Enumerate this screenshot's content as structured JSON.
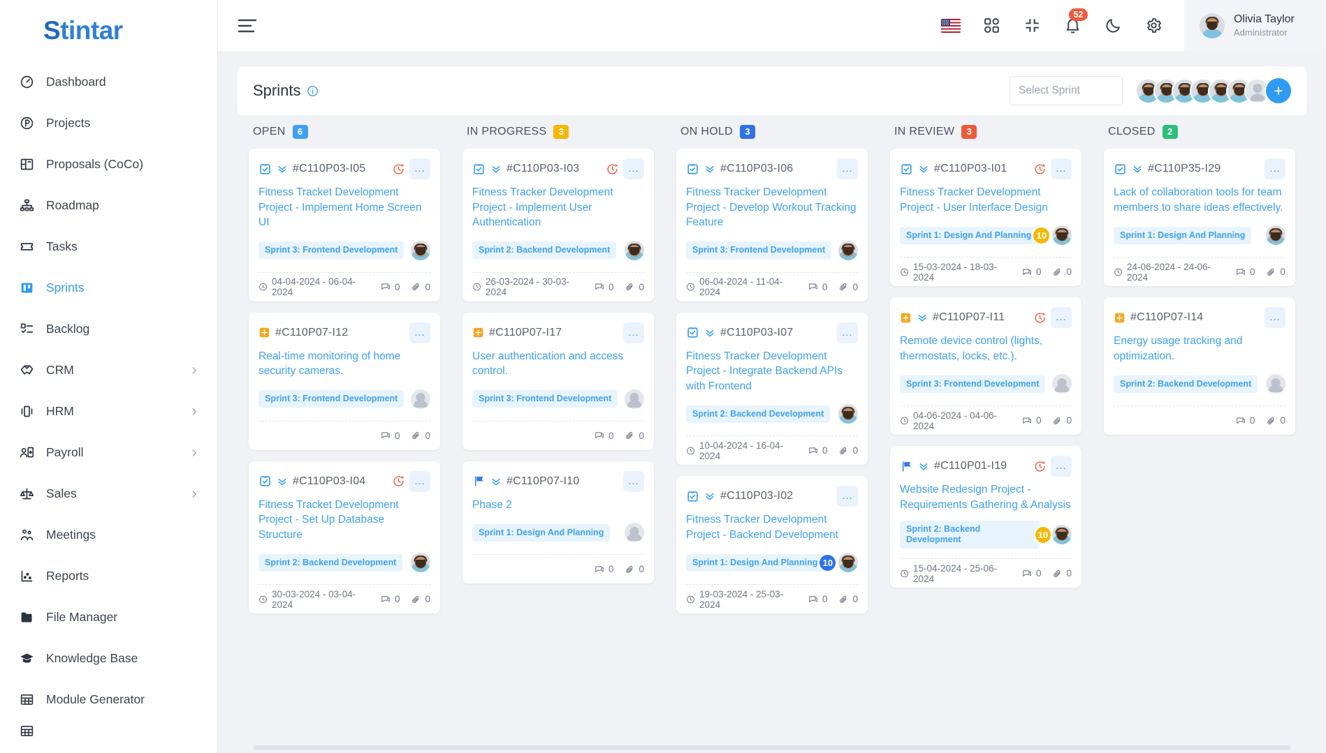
{
  "sidebar": {
    "logo": "Stintar",
    "logo_mark": "S",
    "items": [
      {
        "label": "Dashboard",
        "icon": "speedometer-icon",
        "expandable": false,
        "active": false
      },
      {
        "label": "Projects",
        "icon": "projects-circle-p-icon",
        "expandable": false,
        "active": false
      },
      {
        "label": "Proposals (CoCo)",
        "icon": "proposals-icon",
        "expandable": false,
        "active": false
      },
      {
        "label": "Roadmap",
        "icon": "roadmap-hierarchy-icon",
        "expandable": false,
        "active": false
      },
      {
        "label": "Tasks",
        "icon": "tasks-ticket-icon",
        "expandable": false,
        "active": false
      },
      {
        "label": "Sprints",
        "icon": "sprints-board-icon",
        "expandable": false,
        "active": true
      },
      {
        "label": "Backlog",
        "icon": "backlog-checklist-icon",
        "expandable": false,
        "active": false
      },
      {
        "label": "CRM",
        "icon": "crm-handshake-icon",
        "expandable": true,
        "active": false
      },
      {
        "label": "HRM",
        "icon": "hrm-idcard-icon",
        "expandable": true,
        "active": false
      },
      {
        "label": "Payroll",
        "icon": "payroll-person-icon",
        "expandable": true,
        "active": false
      },
      {
        "label": "Sales",
        "icon": "sales-scale-icon",
        "expandable": true,
        "active": false
      },
      {
        "label": "Meetings",
        "icon": "meetings-people-icon",
        "expandable": false,
        "active": false
      },
      {
        "label": "Reports",
        "icon": "reports-scatter-icon",
        "expandable": false,
        "active": false
      },
      {
        "label": "File Manager",
        "icon": "folder-icon",
        "expandable": false,
        "active": false
      },
      {
        "label": "Knowledge Base",
        "icon": "graduation-cap-icon",
        "expandable": false,
        "active": false
      },
      {
        "label": "Module Generator",
        "icon": "grid-table-icon",
        "expandable": false,
        "active": false
      }
    ]
  },
  "topbar": {
    "menu_icon": "hamburger-menu-icon",
    "language_flag": "us-flag-icon",
    "apps_icon": "apps-grid-icon",
    "fullscreen_icon": "exit-fullscreen-icon",
    "notifications_icon": "bell-icon",
    "notifications_count": "52",
    "theme_icon": "moon-icon",
    "settings_icon": "gear-icon",
    "user_name": "Olivia Taylor",
    "user_role": "Administrator"
  },
  "sprint_header": {
    "title": "Sprints",
    "info_icon": "info-circle-icon",
    "select_placeholder": "Select Sprint",
    "member_avatars": 6,
    "has_placeholder_avatar": true,
    "add_label": "+"
  },
  "colors": {
    "open": "#3fa1ef",
    "in_progress": "#f5b800",
    "on_hold": "#2f72e8",
    "in_review": "#f05a3c",
    "closed": "#2bbf7a",
    "accent": "#2f9bf2",
    "overdue": "#f05a3c"
  },
  "board": {
    "columns": [
      {
        "name": "OPEN",
        "count": "6",
        "color_key": "open",
        "cards": [
          {
            "type_icon": "task-checkbox-icon",
            "priority_icon": "double-chevron-down-icon",
            "id": "#C110P03-I05",
            "overdue": true,
            "menu": "…",
            "title": "Fitness Tracket Development Project - Implement Home Screen UI",
            "sprint": "Sprint 3: Frontend Development",
            "points": null,
            "points_color": null,
            "assignee": "photo",
            "dates": "04-04-2024 - 06-04-2024",
            "comments": "0",
            "attachments": "0",
            "show_dates": true
          },
          {
            "type_icon": "plus-square-icon",
            "priority_icon": null,
            "id": "#C110P07-I12",
            "overdue": false,
            "menu": "…",
            "title": "Real-time monitoring of home security cameras.",
            "sprint": "Sprint 3: Frontend Development",
            "points": null,
            "points_color": null,
            "assignee": "placeholder",
            "dates": "",
            "comments": "0",
            "attachments": "0",
            "show_dates": false
          },
          {
            "type_icon": "task-checkbox-icon",
            "priority_icon": "double-chevron-down-icon",
            "id": "#C110P03-I04",
            "overdue": true,
            "menu": "…",
            "title": "Fitness Tracket Development Project - Set Up Database Structure",
            "sprint": "Sprint 2: Backend Development",
            "points": null,
            "points_color": null,
            "assignee": "photo",
            "dates": "30-03-2024 - 03-04-2024",
            "comments": "0",
            "attachments": "0",
            "show_dates": true
          }
        ]
      },
      {
        "name": "IN PROGRESS",
        "count": "3",
        "color_key": "in_progress",
        "cards": [
          {
            "type_icon": "task-checkbox-icon",
            "priority_icon": "double-chevron-down-icon",
            "id": "#C110P03-I03",
            "overdue": true,
            "menu": "…",
            "title": "Fitness Tracker Development Project - Implement User Authentication",
            "sprint": "Sprint 2: Backend Development",
            "points": null,
            "points_color": null,
            "assignee": "photo",
            "dates": "26-03-2024 - 30-03-2024",
            "comments": "0",
            "attachments": "0",
            "show_dates": true
          },
          {
            "type_icon": "plus-square-icon",
            "priority_icon": null,
            "id": "#C110P07-I17",
            "overdue": false,
            "menu": "…",
            "title": "User authentication and access control.",
            "sprint": "Sprint 3: Frontend Development",
            "points": null,
            "points_color": null,
            "assignee": "placeholder",
            "dates": "",
            "comments": "0",
            "attachments": "0",
            "show_dates": false
          },
          {
            "type_icon": "flag-icon",
            "priority_icon": "double-chevron-down-icon",
            "id": "#C110P07-I10",
            "overdue": false,
            "menu": "…",
            "title": "Phase 2",
            "sprint": "Sprint 1: Design And Planning",
            "points": null,
            "points_color": null,
            "assignee": "placeholder",
            "dates": "",
            "comments": "0",
            "attachments": "0",
            "show_dates": false
          }
        ]
      },
      {
        "name": "ON HOLD",
        "count": "3",
        "color_key": "on_hold",
        "cards": [
          {
            "type_icon": "task-checkbox-icon",
            "priority_icon": "double-chevron-down-icon",
            "id": "#C110P03-I06",
            "overdue": false,
            "menu": "…",
            "title": "Fitness Tracker Development Project - Develop Workout Tracking Feature",
            "sprint": "Sprint 3: Frontend Development",
            "points": null,
            "points_color": null,
            "assignee": "photo",
            "dates": "06-04-2024 - 11-04-2024",
            "comments": "0",
            "attachments": "0",
            "show_dates": true
          },
          {
            "type_icon": "task-checkbox-icon",
            "priority_icon": "double-chevron-down-icon",
            "id": "#C110P03-I07",
            "overdue": false,
            "menu": "…",
            "title": "Fitness Tracker Development Project - Integrate Backend APIs with Frontend",
            "sprint": "Sprint 2: Backend Development",
            "points": null,
            "points_color": null,
            "assignee": "photo",
            "dates": "10-04-2024 - 16-04-2024",
            "comments": "0",
            "attachments": "0",
            "show_dates": true
          },
          {
            "type_icon": "task-checkbox-icon",
            "priority_icon": "double-chevron-down-icon",
            "id": "#C110P03-I02",
            "overdue": false,
            "menu": "…",
            "title": "Fitness Tracker Development Project - Backend Development",
            "sprint": "Sprint 1: Design And Planning",
            "points": "10",
            "points_color": "blue",
            "assignee": "photo",
            "dates": "19-03-2024 - 25-03-2024",
            "comments": "0",
            "attachments": "0",
            "show_dates": true
          }
        ]
      },
      {
        "name": "IN REVIEW",
        "count": "3",
        "color_key": "in_review",
        "cards": [
          {
            "type_icon": "task-checkbox-icon",
            "priority_icon": "double-chevron-down-icon",
            "id": "#C110P03-I01",
            "overdue": true,
            "menu": "…",
            "title": "Fitness Tracker Development Project - User Interface Design",
            "sprint": "Sprint 1: Design And Planning",
            "points": "10",
            "points_color": "amber",
            "assignee": "photo",
            "dates": "15-03-2024 - 18-03-2024",
            "comments": "0",
            "attachments": "0",
            "show_dates": true
          },
          {
            "type_icon": "plus-square-icon",
            "priority_icon": "double-chevron-down-icon",
            "id": "#C110P07-I11",
            "overdue": true,
            "menu": "…",
            "title": "Remote device control (lights, thermostats, locks, etc.).",
            "sprint": "Sprint 3: Frontend Development",
            "points": null,
            "points_color": null,
            "assignee": "placeholder",
            "dates": "04-06-2024 - 04-06-2024",
            "comments": "0",
            "attachments": "0",
            "show_dates": true
          },
          {
            "type_icon": "flag-icon",
            "priority_icon": "double-chevron-down-icon",
            "id": "#C110P01-I19",
            "overdue": true,
            "menu": "…",
            "title": "Website Redesign Project - Requirements Gathering & Analysis",
            "sprint": "Sprint 2: Backend Development",
            "points": "10",
            "points_color": "amber",
            "assignee": "photo",
            "dates": "15-04-2024 - 25-06-2024",
            "comments": "0",
            "attachments": "0",
            "show_dates": true
          }
        ]
      },
      {
        "name": "CLOSED",
        "count": "2",
        "color_key": "closed",
        "cards": [
          {
            "type_icon": "task-checkbox-icon",
            "priority_icon": "double-chevron-down-icon",
            "id": "#C110P35-I29",
            "overdue": false,
            "menu": "…",
            "title": "Lack of collaboration tools for team members to share ideas effectively.",
            "sprint": "Sprint 1: Design And Planning",
            "points": null,
            "points_color": null,
            "assignee": "photo",
            "dates": "24-06-2024 - 24-06-2024",
            "comments": "0",
            "attachments": "0",
            "show_dates": true
          },
          {
            "type_icon": "plus-square-icon",
            "priority_icon": null,
            "id": "#C110P07-I14",
            "overdue": false,
            "menu": "…",
            "title": "Energy usage tracking and optimization.",
            "sprint": "Sprint 2: Backend Development",
            "points": null,
            "points_color": null,
            "assignee": "placeholder",
            "dates": "",
            "comments": "0",
            "attachments": "0",
            "show_dates": false
          }
        ]
      }
    ]
  }
}
